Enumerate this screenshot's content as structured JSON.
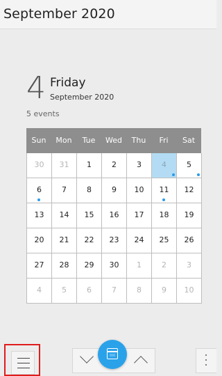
{
  "header": {
    "title": "September 2020"
  },
  "selected_date": {
    "day_number": "4",
    "weekday": "Friday",
    "month_year": "September 2020",
    "events_count": "5 events"
  },
  "calendar": {
    "weekdays": [
      "Sun",
      "Mon",
      "Tue",
      "Wed",
      "Thu",
      "Fri",
      "Sat"
    ],
    "days": [
      {
        "label": "30",
        "muted": true,
        "selected": false,
        "event": false
      },
      {
        "label": "31",
        "muted": true,
        "selected": false,
        "event": false
      },
      {
        "label": "1",
        "muted": false,
        "selected": false,
        "event": false
      },
      {
        "label": "2",
        "muted": false,
        "selected": false,
        "event": false
      },
      {
        "label": "3",
        "muted": false,
        "selected": false,
        "event": false
      },
      {
        "label": "4",
        "muted": false,
        "selected": true,
        "event": true
      },
      {
        "label": "5",
        "muted": false,
        "selected": false,
        "event": true
      },
      {
        "label": "6",
        "muted": false,
        "selected": false,
        "event": true
      },
      {
        "label": "7",
        "muted": false,
        "selected": false,
        "event": false
      },
      {
        "label": "8",
        "muted": false,
        "selected": false,
        "event": false
      },
      {
        "label": "9",
        "muted": false,
        "selected": false,
        "event": false
      },
      {
        "label": "10",
        "muted": false,
        "selected": false,
        "event": false
      },
      {
        "label": "11",
        "muted": false,
        "selected": false,
        "event": true
      },
      {
        "label": "12",
        "muted": false,
        "selected": false,
        "event": false
      },
      {
        "label": "13",
        "muted": false,
        "selected": false,
        "event": false
      },
      {
        "label": "14",
        "muted": false,
        "selected": false,
        "event": false
      },
      {
        "label": "15",
        "muted": false,
        "selected": false,
        "event": false
      },
      {
        "label": "16",
        "muted": false,
        "selected": false,
        "event": false
      },
      {
        "label": "17",
        "muted": false,
        "selected": false,
        "event": false
      },
      {
        "label": "18",
        "muted": false,
        "selected": false,
        "event": false
      },
      {
        "label": "19",
        "muted": false,
        "selected": false,
        "event": false
      },
      {
        "label": "20",
        "muted": false,
        "selected": false,
        "event": false
      },
      {
        "label": "21",
        "muted": false,
        "selected": false,
        "event": false
      },
      {
        "label": "22",
        "muted": false,
        "selected": false,
        "event": false
      },
      {
        "label": "23",
        "muted": false,
        "selected": false,
        "event": false
      },
      {
        "label": "24",
        "muted": false,
        "selected": false,
        "event": false
      },
      {
        "label": "25",
        "muted": false,
        "selected": false,
        "event": false
      },
      {
        "label": "26",
        "muted": false,
        "selected": false,
        "event": false
      },
      {
        "label": "27",
        "muted": false,
        "selected": false,
        "event": false
      },
      {
        "label": "28",
        "muted": false,
        "selected": false,
        "event": false
      },
      {
        "label": "29",
        "muted": false,
        "selected": false,
        "event": false
      },
      {
        "label": "30",
        "muted": false,
        "selected": false,
        "event": false
      },
      {
        "label": "1",
        "muted": true,
        "selected": false,
        "event": false
      },
      {
        "label": "2",
        "muted": true,
        "selected": false,
        "event": false
      },
      {
        "label": "3",
        "muted": true,
        "selected": false,
        "event": false
      },
      {
        "label": "4",
        "muted": true,
        "selected": false,
        "event": false
      },
      {
        "label": "5",
        "muted": true,
        "selected": false,
        "event": false
      },
      {
        "label": "6",
        "muted": true,
        "selected": false,
        "event": false
      },
      {
        "label": "7",
        "muted": true,
        "selected": false,
        "event": false
      },
      {
        "label": "8",
        "muted": true,
        "selected": false,
        "event": false
      },
      {
        "label": "9",
        "muted": true,
        "selected": false,
        "event": false
      },
      {
        "label": "10",
        "muted": true,
        "selected": false,
        "event": false
      }
    ]
  },
  "toolbar": {
    "menu_icon": "hamburger-menu-icon",
    "prev_icon": "chevron-down-icon",
    "today_icon": "calendar-icon",
    "next_icon": "chevron-up-icon",
    "more_icon": "more-vertical-icon"
  },
  "colors": {
    "accent": "#2aa2ea",
    "selected_day": "#b3dcf4",
    "header_row": "#8e8e8e",
    "highlight_outline": "#e01c1c"
  }
}
